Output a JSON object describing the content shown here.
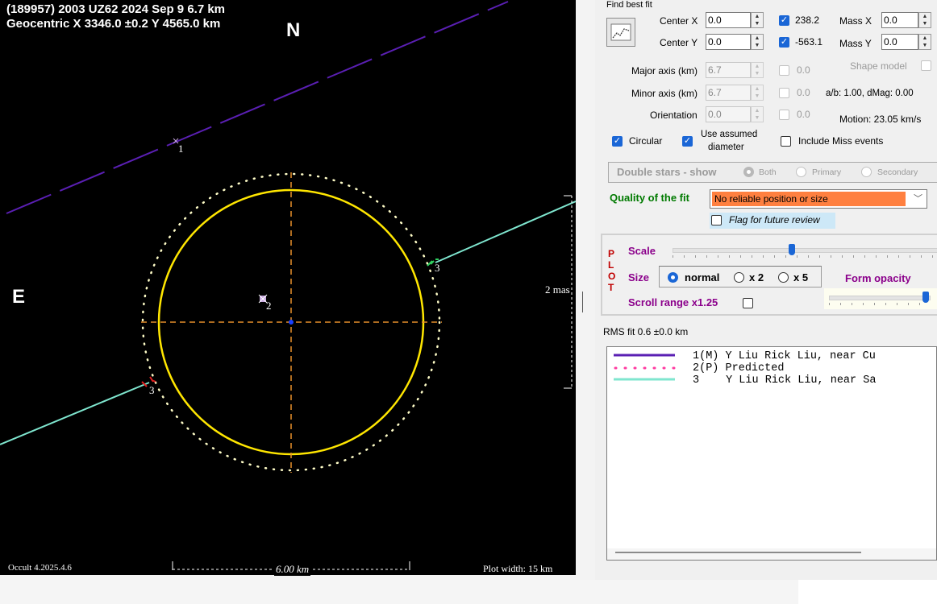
{
  "plot": {
    "title_line1": "(189957) 2003 UZ62  2024 Sep 9  6.7 km",
    "title_line2": "Geocentric X 3346.0 ±0.2 Y 4565.0 km",
    "north": "N",
    "east": "E",
    "scale_2mas": "2 mas",
    "scale_km": "6.00 km",
    "version": "Occult 4.2025.4.6",
    "plot_width": "Plot width: 15 km",
    "chord_labels": [
      "1",
      "2",
      "3",
      "3"
    ],
    "colors": {
      "chord1": "#5a1fb3",
      "chord3": "#7fe6cf",
      "ellipse": "#ffe600",
      "limb": "#fffdc8",
      "axes": "#e8902a"
    }
  },
  "panel": {
    "find_best_fit": "Find best fit",
    "fit_icon": "fit-chart-icon",
    "center_x": {
      "label": "Center X",
      "value": "0.0",
      "checked": true,
      "result": "238.2"
    },
    "center_y": {
      "label": "Center Y",
      "value": "0.0",
      "checked": true,
      "result": "-563.1"
    },
    "mass_x": {
      "label": "Mass X",
      "value": "0.0"
    },
    "mass_y": {
      "label": "Mass Y",
      "value": "0.0"
    },
    "major_axis": {
      "label": "Major axis (km)",
      "value": "6.7",
      "result": "0.0"
    },
    "minor_axis": {
      "label": "Minor axis (km)",
      "value": "6.7",
      "result": "0.0"
    },
    "orientation": {
      "label": "Orientation",
      "value": "0.0",
      "result": "0.0"
    },
    "shape_model": "Shape model",
    "ab_dmag": "a/b: 1.00, dMag: 0.00",
    "motion": "Motion: 23.05 km/s",
    "circular": "Circular",
    "use_assumed_line1": "Use assumed",
    "use_assumed_line2": "diameter",
    "include_miss": "Include Miss events",
    "double_stars": "Double stars - show",
    "ds_both": "Both",
    "ds_primary": "Primary",
    "ds_secondary": "Secondary",
    "quality_label": "Quality of the fit",
    "quality_value": "No reliable position or size",
    "flag_review": "Flag for future review",
    "plot_letters": [
      "P",
      "L",
      "O",
      "T"
    ],
    "scale": "Scale",
    "scale_level": 0.45,
    "size": "Size",
    "size_normal": "normal",
    "size_x2": "x 2",
    "size_x5": "x 5",
    "form_opacity": "Form opacity",
    "opacity_level": 1.0,
    "scroll_range": "Scroll range x1.25",
    "rms": "RMS fit 0.6 ±0.0 km",
    "legend": [
      {
        "num": "1(M)",
        "text": "Y Liu Rick Liu, near Cu"
      },
      {
        "num": "2(P)",
        "text": "Predicted"
      },
      {
        "num": "3",
        "text": "Y Liu Rick Liu, near Sa"
      }
    ],
    "colors": {
      "quality_bg": "#ff8040",
      "quality_label": "#007a00",
      "plot_red": "#c00000",
      "form_opacity": "#8b008b",
      "accent": "#1a66d6"
    }
  }
}
